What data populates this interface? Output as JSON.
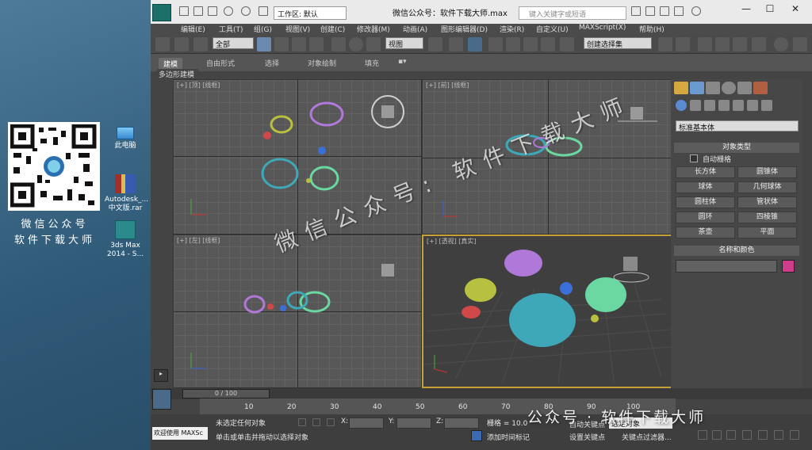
{
  "desktop": {
    "qr_caption_line1": "微信公众号",
    "qr_caption_line2": "软件下载大师",
    "icons": [
      {
        "label": "此电脑",
        "icon": "computer-icon",
        "color": "#4aa0e0"
      },
      {
        "label": "Autodesk_... 中文版.rar",
        "icon": "rar-archive-icon",
        "color": "#a0302a"
      },
      {
        "label": "3ds Max 2014 - S...",
        "icon": "3dsmax-icon",
        "color": "#2a8a8c"
      }
    ]
  },
  "window": {
    "title": "微信公众号：软件下载大师.max",
    "workspace": "工作区: 默认",
    "search_placeholder": "键入关键字或短语",
    "minimize": "—",
    "maximize": "☐",
    "close": "✕"
  },
  "menu": [
    "编辑(E)",
    "工具(T)",
    "组(G)",
    "视图(V)",
    "创建(C)",
    "修改器(M)",
    "动画(A)",
    "图形编辑器(D)",
    "渲染(R)",
    "自定义(U)",
    "MAXScript(X)",
    "帮助(H)"
  ],
  "toolbar": {
    "selection_filter": "全部",
    "reference_coord": "视图",
    "named_selection": "创建选择集"
  },
  "ribbon": {
    "tabs": [
      "建模",
      "自由形式",
      "选择",
      "对象绘制",
      "填充"
    ],
    "active": "建模",
    "sub_label": "多边形建模"
  },
  "viewports": {
    "top": "[+] [顶] [线框]",
    "front": "[+] [前] [线框]",
    "left": "[+] [左] [线框]",
    "perspective": "[+] [透视] [真实]"
  },
  "command_panel": {
    "category": "标准基本体",
    "object_type_header": "对象类型",
    "autogrid": "自动栅格",
    "objects": [
      "长方体",
      "圆锥体",
      "球体",
      "几何球体",
      "圆柱体",
      "管状体",
      "圆环",
      "四棱锥",
      "茶壶",
      "平面"
    ],
    "name_color_header": "名称和颜色",
    "object_color": "#d03c8c"
  },
  "timeline": {
    "frame": "0 / 100",
    "ticks": [
      "10",
      "20",
      "30",
      "40",
      "50",
      "60",
      "70",
      "80",
      "90",
      "100"
    ]
  },
  "status": {
    "selection": "未选定任何对象",
    "prompt": "单击或单击并拖动以选择对象",
    "welcome": "欢迎使用 MAXSc",
    "x_label": "X:",
    "y_label": "Y:",
    "z_label": "Z:",
    "grid": "栅格 = 10.0",
    "add_time_tag": "添加时间标记",
    "set_key": "设置关键点",
    "key_filter": "关键点过滤器...",
    "auto_key": "自动关键点",
    "key_mode": "选定对象"
  },
  "watermark": {
    "diagonal": "微信公众号: 软件下载大师",
    "bottom": "公众号 · 软件下载大师"
  },
  "colors": {
    "accent": "#1d6f6a",
    "highlight": "#d8a840",
    "teapot_cyan": "#3ea8b8",
    "teapot_purple": "#b078d8",
    "teapot_yellow": "#b8c040",
    "teapot_green": "#6ad8a0",
    "teapot_red": "#d04848",
    "teapot_blue": "#3a70d8"
  }
}
